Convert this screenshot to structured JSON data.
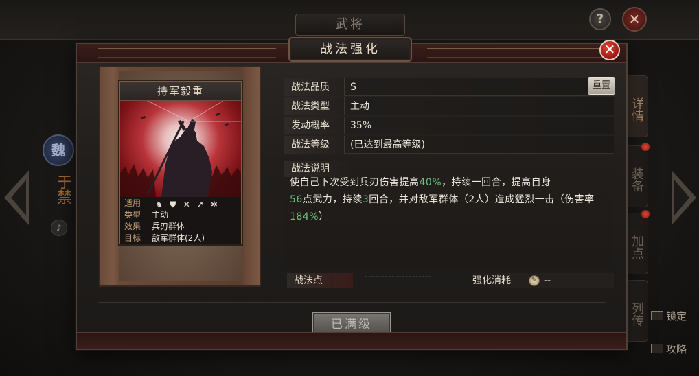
{
  "background": {
    "screen_title": "武将",
    "help_label": "?",
    "close_label": "✕",
    "faction_badge": "魏",
    "hero_name": "于禁",
    "side_tabs": [
      {
        "label": "详情",
        "active": true
      },
      {
        "label": "装备",
        "active": false
      },
      {
        "label": "加点",
        "active": false
      },
      {
        "label": "列传",
        "active": false
      }
    ],
    "links": [
      {
        "label": "锁定",
        "icon": "lock-icon"
      },
      {
        "label": "攻略",
        "icon": "guide-icon"
      }
    ]
  },
  "modal": {
    "title": "战法强化",
    "close_label": "✕",
    "card": {
      "name": "持军毅重",
      "art_description_colors": {
        "primary": "#b8343a",
        "highlight": "#f2e8e6"
      },
      "applies_label": "适用",
      "applies_icons": [
        "cavalry-icon",
        "shield-icon",
        "crossbow-icon",
        "spear-icon",
        "siege-icon"
      ],
      "type_label": "类型",
      "type_value": "主动",
      "effect_label": "效果",
      "effect_value": "兵刃群体",
      "target_label": "目标",
      "target_value": "敌军群体(2人)"
    },
    "details": {
      "quality_label": "战法品质",
      "quality_value": "S",
      "reset_label": "重置",
      "type_label": "战法类型",
      "type_value": "主动",
      "chance_label": "发动概率",
      "chance_value": "35%",
      "level_label": "战法等级",
      "level_value": "(已达到最高等级)",
      "desc_label": "战法说明",
      "desc_parts": [
        {
          "text": "使自己下次受到兵刃伤害提高",
          "green": false
        },
        {
          "text": "40%",
          "green": true
        },
        {
          "text": "，持续一回合，提高自身",
          "green": false
        },
        {
          "text": "56",
          "green": true
        },
        {
          "text": "点武力，持续",
          "green": false
        },
        {
          "text": "3",
          "green": true
        },
        {
          "text": "回合，并对敌军群体（2人）造成猛烈一击（伤害率",
          "green": false
        },
        {
          "text": "184%",
          "green": true
        },
        {
          "text": "）",
          "green": false
        }
      ],
      "points_label": "战法点",
      "cost_label": "强化消耗",
      "cost_value": "--"
    },
    "max_level_button": "已满级"
  },
  "colors": {
    "accent_green": "#6cc07a",
    "close_red": "#d8352c",
    "label_gold": "#c4a27a"
  }
}
